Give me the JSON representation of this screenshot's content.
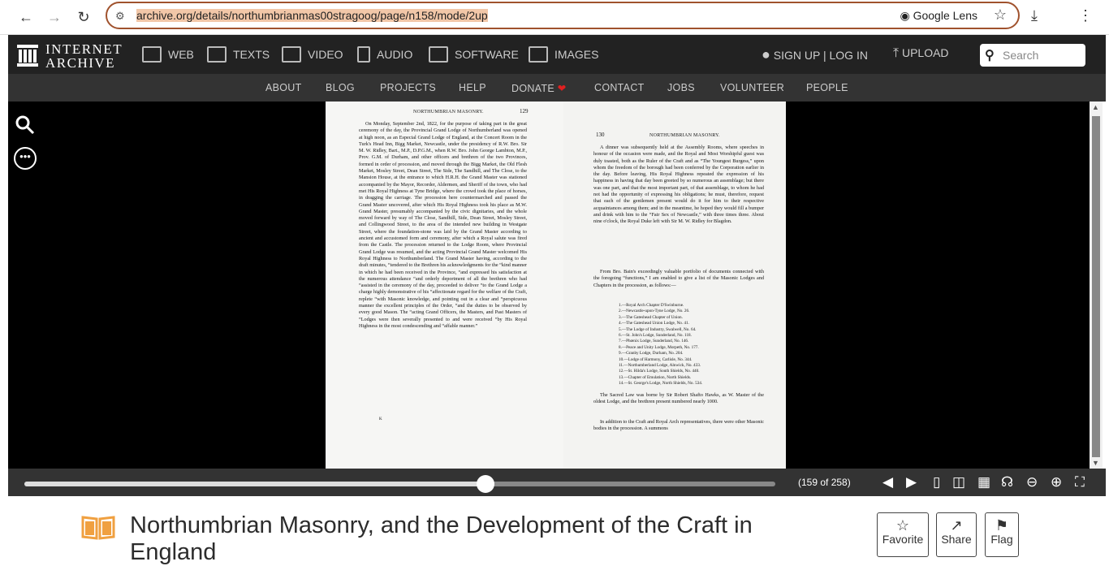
{
  "browser": {
    "url_highlight": "archive.org/details/northumbrianmas00stragoog/page/n158/mode/2up",
    "lens_label": "Google Lens"
  },
  "ia_header": {
    "logo_line1": "INTERNET",
    "logo_line2": "ARCHIVE",
    "categories": [
      {
        "label": "WEB",
        "icon": "web-icon"
      },
      {
        "label": "TEXTS",
        "icon": "book-icon"
      },
      {
        "label": "VIDEO",
        "icon": "film-icon"
      },
      {
        "label": "AUDIO",
        "icon": "speaker-icon"
      },
      {
        "label": "SOFTWARE",
        "icon": "floppy-icon"
      },
      {
        "label": "IMAGES",
        "icon": "image-icon"
      }
    ],
    "signup_label": "SIGN UP | LOG IN",
    "upload_label": "UPLOAD",
    "search_placeholder": "Search",
    "sublinks": [
      "ABOUT",
      "BLOG",
      "PROJECTS",
      "HELP",
      "DONATE",
      "CONTACT",
      "JOBS",
      "VOLUNTEER",
      "PEOPLE"
    ]
  },
  "book": {
    "left_page": {
      "header": "NORTHUMBRIAN MASONRY.",
      "number": "129",
      "text": "On Monday, September 2nd, 1822, for the purpose of taking part in the great ceremony of the day, the Provincial Grand Lodge of Northumberland was opened at high noon, as an Especial Grand Lodge of England, at the Concert Room in the Turk's Head Inn, Bigg Market, Newcastle, under the presidency of R.W. Bro. Sir M. W. Ridley, Bart., M.P., D.P.G.M., when R.W. Bro. John George Lambton, M.P., Prov. G.M. of Durham, and other officers and brethren of the two Provinces, formed in order of procession, and moved through the Bigg Market, the Old Flesh Market, Mosley Street, Dean Street, The Side, The Sandhill, and The Close, to the Mansion House, at the entrance to which H.R.H. the Grand Master was stationed accompanied by the Mayor, Recorder, Aldermen, and Sheriff of the town, who had met His Royal Highness at Tyne Bridge, where the crowd took the place of horses, in dragging the carriage. The procession here countermarched and passed the Grand Master uncovered, after which His Royal Highness took his place as M.W. Grand Master, presumably accompanied by the civic dignitaries, and the whole moved forward by way of The Close, Sandhill, Side, Dean Street, Mosley Street, and Collingwood Street, to the area of the intended new building in Westgate Street, where the foundation-stone was laid by the Grand Master according to ancient and accustomed form and ceremony, after which a Royal salute was fired from the Castle. The procession returned to the Lodge Room, where Provincial Grand Lodge was resumed, and the acting Provincial Grand Master welcomed His Royal Highness to Northumberland. The Grand Master having, according to the draft minutes, “tendered to the Brethren his acknowledgments for the “kind manner in which he had been received in the Province, “and expressed his satisfaction at the numerous attendance “and orderly deportment of all the brethren who had “assisted in the ceremony of the day, proceeded to deliver “to the Grand Lodge a charge highly demonstrative of his “affectionate regard for the welfare of the Craft, replete “with Masonic knowledge, and pointing out in a clear and “perspicuous manner the excellent principles of the Order, “and the duties to be observed by every good Mason. The “acting Grand Officers, the Masters, and Past Masters of “Lodges were then severally presented to and were received “by His Royal Highness in the most condescending and “affable manner.”",
      "signature": "K"
    },
    "right_page": {
      "number": "130",
      "header": "NORTHUMBRIAN MASONRY.",
      "para1": "A dinner was subsequently held at the Assembly Rooms, where speeches in honour of the occasion were made, and the Royal and Most Worshipful guest was duly toasted, both as the Ruler of the Craft and as “The Youngest Burgess,” upon whom the freedom of the borough had been conferred by the Corporation earlier in the day. Before leaving, His Royal Highness repeated the expression of his happiness in having that day been greeted by so numerous an assemblage; but there was one part, and that the most important part, of that assemblage, to whom he had not had the opportunity of expressing his obligations; he must, therefore, request that each of the gentlemen present would do it for him to their respective acquaintances among them; and in the meantime, he hoped they would fill a bumper and drink with him to the “Fair Sex of Newcastle,” with three times three. About nine o'clock, the Royal Duke left with Sir M. W. Ridley for Blagdon.",
      "para2": "From Bro. Bain's exceedingly valuable portfolio of documents connected with the foregoing “functions,” I am enabled to give a list of the Masonic Lodges and Chapters in the procession, as follows:—",
      "lodges": [
        "1.—Royal Arch Chapter D'Swinburne.",
        "2.—Newcastle-upon-Tyne Lodge, No. 26.",
        "3.—The Gateshead Chapter of Union.",
        "4.—The Gateshead Union Lodge, No. 41.",
        "5.—The Lodge of Industry, Swalwell, No. 64.",
        "6.—St. John's Lodge, Sunderland, No. 118.",
        "7.—Phœnix Lodge, Sunderland, No. 146.",
        "8.—Peace and Unity Lodge, Morpeth, No. 177.",
        "9.—Granby Lodge, Durham, No. 204.",
        "10.—Lodge of Harmony, Carlisle, No. 344.",
        "11.—Northumberland Lodge, Alnwick, No. 433.",
        "12.—St. Hilda's Lodge, South Shields, No. 440.",
        "13.—Chapter of Emulation, North Shields.",
        "14.—St. George's Lodge, North Shields, No. 534."
      ],
      "para3": "The Sacred Law was borne by Sir Robert Shafto Hawks, as W. Master of the oldest Lodge, and the brethren present numbered nearly 1000.",
      "para4": "In addition to the Craft and Royal Arch representatives, there were other Masonic bodies in the procession. A summons"
    }
  },
  "reader": {
    "page_count": "(159 of 258)",
    "progress_fraction": 0.614
  },
  "item": {
    "title": "Northumbrian Masonry, and the Development of the Craft in England",
    "favorite_label": "Favorite",
    "share_label": "Share",
    "flag_label": "Flag"
  },
  "colors": {
    "accent": "#a0522d",
    "heart": "#e02020",
    "book_icon": "#f0a040"
  }
}
